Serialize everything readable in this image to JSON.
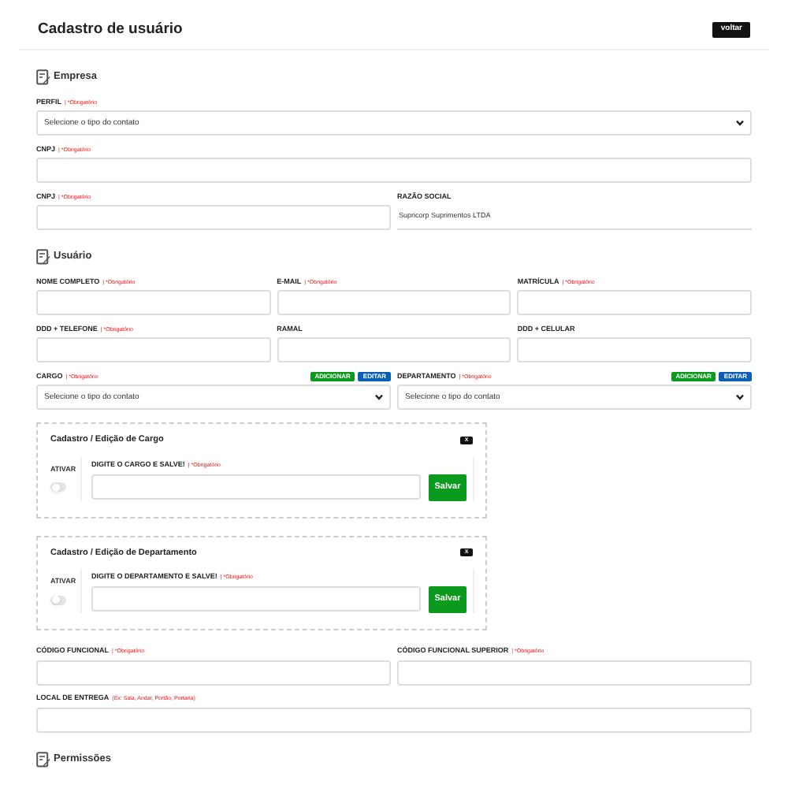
{
  "header": {
    "title": "Cadastro de usuário",
    "back_button": "voltar"
  },
  "sections": [
    {
      "title": "Empresa",
      "rows": [
        {
          "fields": [
            {
              "label": "PERFIL",
              "hint": "| *Obrigatório",
              "kind": "select",
              "value": "Selecione o tipo do contato"
            }
          ]
        },
        {
          "fields": [
            {
              "label": "CNPJ",
              "hint": "| *Obrigatório",
              "kind": "input"
            }
          ]
        },
        {
          "fields": [
            {
              "label": "CNPJ",
              "hint": "| *Obrigatório",
              "kind": "input"
            },
            {
              "label": "RAZÃO SOCIAL",
              "kind": "readonly",
              "value": "Supricorp Suprimentos LTDA"
            }
          ]
        }
      ]
    },
    {
      "title": "Usuário",
      "rows": [
        {
          "fields": [
            {
              "label": "NOME COMPLETO",
              "hint": "| *Obrigatório",
              "kind": "input"
            },
            {
              "label": "E-MAIL",
              "hint": "| *Obrigatório",
              "kind": "input"
            },
            {
              "label": "MATRÍCULA",
              "hint": "| *Obrigatório",
              "kind": "input"
            }
          ]
        },
        {
          "fields": [
            {
              "label": "DDD + TELEFONE",
              "hint": "| *Obrigatório",
              "kind": "input"
            },
            {
              "label": "RAMAL",
              "kind": "input"
            },
            {
              "label": "DDD + CELULAR",
              "kind": "input"
            }
          ]
        },
        {
          "fields": [
            {
              "label": "CARGO",
              "hint": "| *Obrigatório",
              "kind": "select",
              "value": "Selecione o tipo do contato",
              "actions": [
                {
                  "label": "ADICIONAR",
                  "kind": "add"
                },
                {
                  "label": "EDITAR",
                  "kind": "edit"
                }
              ]
            },
            {
              "label": "DEPARTAMENTO",
              "hint": "| *Obrigatório",
              "kind": "select",
              "value": "Selecione o tipo do contato",
              "actions": [
                {
                  "label": "ADICIONAR",
                  "kind": "add"
                },
                {
                  "label": "EDITAR",
                  "kind": "edit"
                }
              ]
            }
          ]
        }
      ],
      "panels": [
        {
          "title": "Cadastro / Edição de Cargo",
          "close": "X",
          "toggle_label": "ATIVAR",
          "on": false,
          "field_label": "DIGITE O CARGO E SALVE!",
          "hint": "| *Obrigatório",
          "save": "Salvar"
        },
        {
          "title": "Cadastro / Edição de Departamento",
          "close": "X",
          "toggle_label": "ATIVAR",
          "on": false,
          "field_label": "DIGITE O DEPARTAMENTO E SALVE!",
          "hint": "| *Obrigatório",
          "save": "Salvar"
        }
      ],
      "rows_after": [
        {
          "fields": [
            {
              "label": "CÓDIGO FUNCIONAL",
              "hint": "| *Obrigatório",
              "kind": "input"
            },
            {
              "label": "CÓDIGO FUNCIONAL SUPERIOR",
              "hint": "| *Obrigatório",
              "kind": "input"
            }
          ]
        },
        {
          "fields": [
            {
              "label": "LOCAL DE ENTREGA",
              "hint": "(Ex: Sala, Andar, Portão, Portaria)",
              "kind": "input"
            }
          ]
        }
      ]
    },
    {
      "title": "Permissões"
    }
  ]
}
